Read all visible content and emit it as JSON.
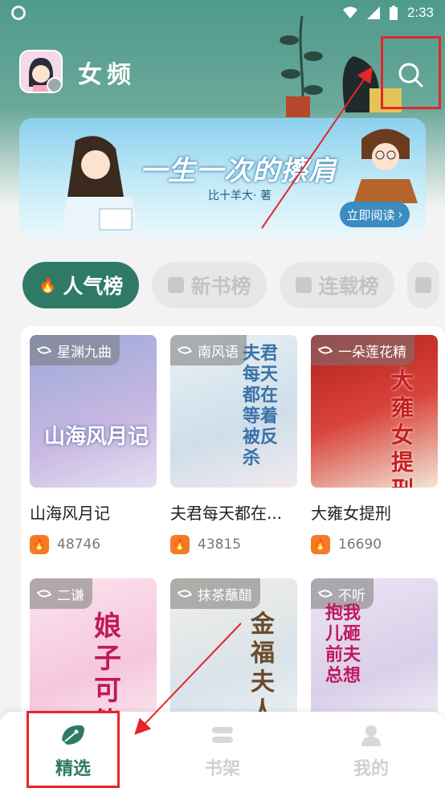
{
  "status_bar": {
    "time": "2:33"
  },
  "header": {
    "channel": "女频"
  },
  "banner": {
    "title": "一生一次的擦肩",
    "author": "比十羊大· 著",
    "button_label": "立即阅读"
  },
  "tabs": [
    {
      "label": "人气榜",
      "active": true
    },
    {
      "label": "新书榜",
      "active": false
    },
    {
      "label": "连载榜",
      "active": false
    }
  ],
  "books": [
    {
      "author": "星渊九曲",
      "cover_text": "山海风月记",
      "title": "山海风月记",
      "count": "48746"
    },
    {
      "author": "南风语",
      "cover_text": "夫君每天都在等着被反杀",
      "title": "夫君每天都在...",
      "count": "43815"
    },
    {
      "author": "一朵莲花精",
      "cover_text": "大雍女提刑",
      "title": "大雍女提刑",
      "count": "16690"
    },
    {
      "author": "二谦",
      "cover_text": "娘子可能",
      "title": "",
      "count": ""
    },
    {
      "author": "抹茶蘸醋",
      "cover_text": "金福夫人",
      "title": "",
      "count": ""
    },
    {
      "author": "不听",
      "cover_text": "抱我儿砸前夫总想",
      "title": "",
      "count": ""
    }
  ],
  "bottom_nav": [
    {
      "label": "精选",
      "icon": "leaf-logo-icon",
      "active": true
    },
    {
      "label": "书架",
      "icon": "bookshelf-icon",
      "active": false
    },
    {
      "label": "我的",
      "icon": "profile-icon",
      "active": false
    }
  ],
  "colors": {
    "accent": "#2f7a66",
    "highlight": "#e3262b",
    "flame": "#f47b25"
  }
}
